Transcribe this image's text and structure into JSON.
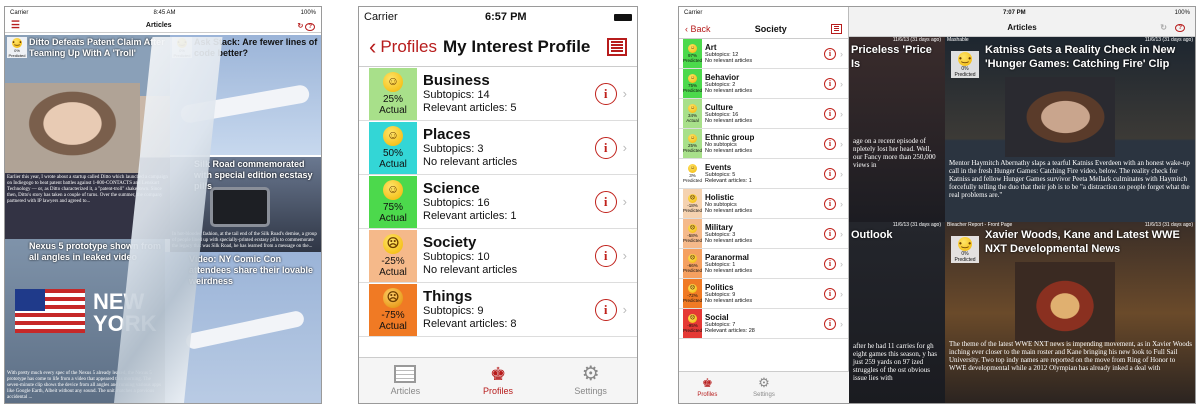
{
  "colors": {
    "accent": "#b71c1c",
    "green": "#4cd94c",
    "cyan": "#33d6d6",
    "peach": "#f5b98a",
    "orange": "#f07a24",
    "lightgreen": "#a8e08a"
  },
  "phone1": {
    "status": {
      "carrier": "Carrier",
      "time": "8:45 AM",
      "battery": "100%"
    },
    "nav_title": "Articles",
    "tiles": [
      {
        "headline": "Ditto Defeats Patent Claim After Teaming Up With A 'Troll'",
        "pct": "0%",
        "label": "Predicted",
        "body": "Earlier this year, I wrote about a startup called Ditto which launched a campaign on Indiegogo to beat patent battles against 1-800-CONTACTS and Lenskart Technology — or, as Ditto characterized it, a \"patent-troll\" shakedown. Since then, Ditto's story has taken a couple of turns. Over the summer, the company partnered with IP lawyers and agreed to...",
        "image": "woman-video-still"
      },
      {
        "headline": "Ask Stack: Are fewer lines of code better?",
        "pct": "0%",
        "label": "Predicted",
        "body": "",
        "image": "airplane"
      },
      {
        "headline": "Silk Road commemorated with special edition ecstasy pills",
        "meta": "Oct 13, 2013, 3:27 PM",
        "body": "In hot-blooded fashion, at the tail end of the Silk Road's demise, a group of people lined up with specially-printed ecstasy pills to commemorate the legacy that was Silk Road, he has learned from a message on the...",
        "image": "smartwatch"
      },
      {
        "headline": "Nexus 5 prototype shown from all angles in leaked video",
        "body": "With pretty much every spec of the Nexus 5 already leaked, the Nexus 5 prototype has come to life from a video that appeared this morning. The seven-minute clip shows the device from all angles and running various apps like Google Earth, Albeit without any sound. The unit matches a previous accidental ...",
        "image": "new-york-flag"
      },
      {
        "headline": "Video: NY Comic Con attendees share their lovable weirdness",
        "body": "",
        "image": "airplane"
      }
    ]
  },
  "phone2": {
    "status": {
      "carrier": "Carrier",
      "time": "6:57 PM"
    },
    "back_label": "Profiles",
    "title": "My Interest Profile",
    "profiles": [
      {
        "name": "Business",
        "line1": "Subtopics: 14",
        "line2": "Relevant articles: 5",
        "pct": "25%",
        "label": "Actual",
        "color": "#a8e08a",
        "face": "☺"
      },
      {
        "name": "Places",
        "line1": "Subtopics: 3",
        "line2": "No relevant articles",
        "pct": "50%",
        "label": "Actual",
        "color": "#33d6d6",
        "face": "☺"
      },
      {
        "name": "Science",
        "line1": "Subtopics: 16",
        "line2": "Relevant articles: 1",
        "pct": "75%",
        "label": "Actual",
        "color": "#4cd94c",
        "face": "☺"
      },
      {
        "name": "Society",
        "line1": "Subtopics: 10",
        "line2": "No relevant articles",
        "pct": "-25%",
        "label": "Actual",
        "color": "#f5b98a",
        "face": "☹"
      },
      {
        "name": "Things",
        "line1": "Subtopics: 9",
        "line2": "Relevant articles: 8",
        "pct": "-75%",
        "label": "Actual",
        "color": "#f07a24",
        "face": "☹"
      }
    ],
    "tabs": [
      {
        "label": "Articles"
      },
      {
        "label": "Profiles"
      },
      {
        "label": "Settings"
      }
    ]
  },
  "phone3": {
    "status": {
      "carrier": "Carrier",
      "time": "7:07 PM",
      "battery": "100%"
    },
    "back_label": "Back",
    "sidebar_title": "Society",
    "main_title": "Articles",
    "topics": [
      {
        "name": "Art",
        "line1": "Subtopics: 12",
        "line2": "No relevant articles",
        "pct": "97%",
        "label": "Predicted",
        "color": "#4cd94c"
      },
      {
        "name": "Behavior",
        "line1": "Subtopics: 2",
        "line2": "No relevant articles",
        "pct": "75%",
        "label": "Predicted",
        "color": "#4cd94c"
      },
      {
        "name": "Culture",
        "line1": "Subtopics: 16",
        "line2": "No relevant articles",
        "pct": "34%",
        "label": "Actual",
        "color": "#a8e08a"
      },
      {
        "name": "Ethnic group",
        "line1": "No subtopics",
        "line2": "No relevant articles",
        "pct": "25%",
        "label": "Predicted",
        "color": "#a8e08a"
      },
      {
        "name": "Events",
        "line1": "Subtopics: 5",
        "line2": "Relevant articles: 1",
        "pct": "3%",
        "label": "Predicted",
        "color": "#ffffff"
      },
      {
        "name": "Holistic",
        "line1": "No subtopics",
        "line2": "No relevant articles",
        "pct": "-18%",
        "label": "Predicted",
        "color": "#f5d2b0"
      },
      {
        "name": "Military",
        "line1": "Subtopics: 3",
        "line2": "No relevant articles",
        "pct": "-58%",
        "label": "Predicted",
        "color": "#f5b98a"
      },
      {
        "name": "Paranormal",
        "line1": "Subtopics: 1",
        "line2": "No relevant articles",
        "pct": "-66%",
        "label": "Predicted",
        "color": "#f5a060"
      },
      {
        "name": "Politics",
        "line1": "Subtopics: 9",
        "line2": "No relevant articles",
        "pct": "-72%",
        "label": "Predicted",
        "color": "#f07a24"
      },
      {
        "name": "Social",
        "line1": "Subtopics: 7",
        "line2": "Relevant articles: 28",
        "pct": "-95%",
        "label": "Predicted",
        "color": "#e53935"
      }
    ],
    "articles": [
      {
        "headline": "Priceless 'Price Is",
        "source": "",
        "meta": "11/6/13 (31 days ago)",
        "body": "age on a recent episode of npletely lost her head. Well, our Fancy more than 250,000 views in",
        "image": "dark"
      },
      {
        "headline": "Katniss Gets a Reality Check in New 'Hunger Games: Catching Fire' Clip",
        "source": "Mashable",
        "meta": "11/6/13 (31 days ago)",
        "pct": "0%",
        "label": "Predicted",
        "body": "Mentor Haymitch Abernathy slaps a tearful Katniss Everdeen with an honest wake-up call in the fresh Hunger Games: Catching Fire video, below. The reality check for Katniss and fellow Hunger Games survivor Peeta Mellark culminates with Haymitch forcefully telling the duo that their job is to be \"a distraction so people forget what the real problems are.\"",
        "image": "movie-still"
      },
      {
        "headline": "Outlook",
        "source": "",
        "meta": "11/6/13 (31 days ago)",
        "body": "after he had 11 carries for gh eight games this season, y has just 259 yards on 97 ized struggles of the ost obvious issue lies with",
        "image": "dark"
      },
      {
        "headline": "Xavier Woods, Kane and Latest WWE NXT Developmental News",
        "source": "Bleacher Report - Front Page",
        "meta": "11/6/13 (31 days ago)",
        "pct": "0%",
        "label": "Predicted",
        "body": "The theme of the latest WWE NXT news is impending movement, as in Xavier Woods inching ever closer to the main roster and Kane bringing his new look to Full Sail University. Two top indy names are reported on the move from Ring of Honor to WWE developmental while a 2012 Olympian has already inked a deal with",
        "image": "wrestler"
      }
    ],
    "tabs": [
      {
        "label": "Profiles"
      },
      {
        "label": "Settings"
      }
    ]
  }
}
